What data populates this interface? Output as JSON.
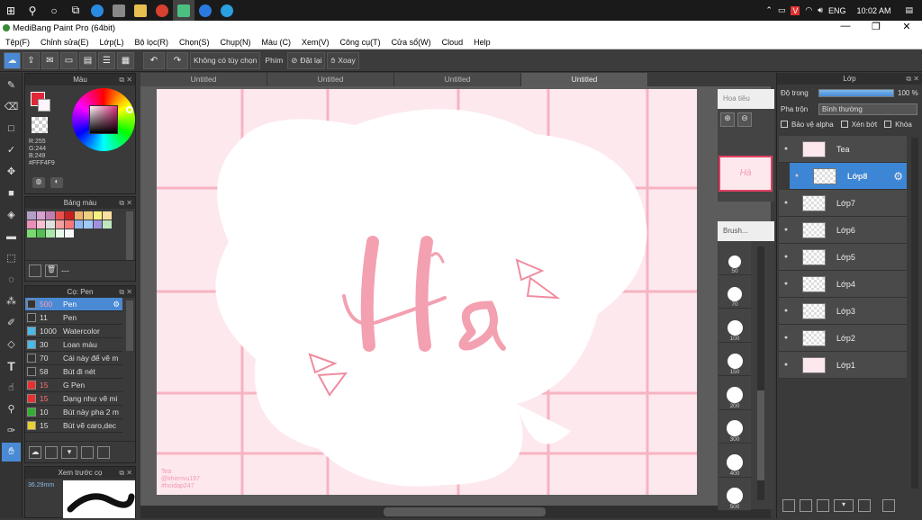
{
  "taskbar": {
    "time": "10:02 AM",
    "lang": "ENG"
  },
  "window": {
    "title": "MediBang Paint Pro (64bit)",
    "minimize": "—",
    "restore": "❐",
    "close": "✕"
  },
  "menu": [
    "Tệp(F)",
    "Chỉnh sửa(E)",
    "Lớp(L)",
    "Bộ lọc(R)",
    "Chọn(S)",
    "Chụp(N)",
    "Màu (C)",
    "Xem(V)",
    "Công cụ(T)",
    "Cửa sổ(W)",
    "Cloud",
    "Help"
  ],
  "toolbar": {
    "undo_label": "↶",
    "redo_label": "↷",
    "stabilizer": "Không có tùy chọn",
    "hotkey": "Phím",
    "reset": "Đặt lại",
    "rotate": "Xoay"
  },
  "color_panel": {
    "title": "Màu",
    "r": "R:255",
    "g": "G:244",
    "b": "B:249",
    "hex": "#FFF4F9"
  },
  "palette_panel": {
    "title": "Bảng màu",
    "name": "---",
    "colors": [
      "#b0a0c8",
      "#d8a0d0",
      "#c080b0",
      "#e85050",
      "#c82020",
      "#f0b070",
      "#f0d080",
      "#f8f080",
      "#f8e0a0",
      "#e890b8",
      "#f8c0d0",
      "#e0e0e0",
      "#f0a0a0",
      "#f87878",
      "#90b8f0",
      "#a0c8f8",
      "#a090e0",
      "#c0e8c0",
      "#7cd870",
      "#50c050",
      "#a8e8a8",
      "#e8f8e8",
      "#f8f8f8"
    ]
  },
  "brush_panel": {
    "title": "Cọ: Pen",
    "items": [
      {
        "size": "500",
        "name": "Pen",
        "color": "#333333",
        "selected": true
      },
      {
        "size": "11",
        "name": "Pen",
        "color": "#333333"
      },
      {
        "size": "1000",
        "name": "Watercolor",
        "color": "#4ab8e8"
      },
      {
        "size": "30",
        "name": "Loan màu",
        "color": "#4ab8e8"
      },
      {
        "size": "70",
        "name": "Cái này để vẽ m",
        "color": "#333333"
      },
      {
        "size": "58",
        "name": "Bút đi nét",
        "color": "#333333"
      },
      {
        "size": "15",
        "name": "G Pen",
        "color": "#e83030"
      },
      {
        "size": "15",
        "name": "Dạng như vẽ mi",
        "color": "#e83030"
      },
      {
        "size": "10",
        "name": "Bút này pha 2 m",
        "color": "#30b030"
      },
      {
        "size": "15",
        "name": "Bút vẽ caro,dec",
        "color": "#e8d030"
      }
    ]
  },
  "preview_panel": {
    "title": "Xem trước cọ",
    "size": "36.29mm"
  },
  "tabs": [
    "Untitled",
    "Untitled",
    "Untitled",
    "Untitled"
  ],
  "canvas": {
    "text": "Hà",
    "watermark1": "Tea",
    "watermark2": "@khienvu197",
    "watermark3": "#hoidap247"
  },
  "navigator": {
    "title": "Hoa tiêu"
  },
  "brush_sizes": {
    "title": "Brush...",
    "values": [
      "50",
      "70",
      "100",
      "150",
      "200",
      "300",
      "400",
      "500"
    ]
  },
  "layers_panel": {
    "title": "Lớp",
    "opacity_label": "Độ trong",
    "opacity_value": "100 %",
    "blend_label": "Pha trộn",
    "blend_value": "Bình thường",
    "protect_alpha": "Bảo vệ alpha",
    "clipping": "Xén bớt",
    "lock": "Khóa",
    "layers": [
      {
        "name": "Tea",
        "selected": false
      },
      {
        "name": "Lớp8",
        "selected": true
      },
      {
        "name": "Lớp7",
        "selected": false
      },
      {
        "name": "Lớp6",
        "selected": false
      },
      {
        "name": "Lớp5",
        "selected": false
      },
      {
        "name": "Lớp4",
        "selected": false
      },
      {
        "name": "Lớp3",
        "selected": false
      },
      {
        "name": "Lớp2",
        "selected": false
      },
      {
        "name": "Lớp1",
        "selected": false
      }
    ]
  },
  "colors": {
    "accent": "#4a8ad4",
    "canvas_bg": "#fde8ee",
    "grid": "#f7b6c6",
    "letter": "#f49aab"
  }
}
